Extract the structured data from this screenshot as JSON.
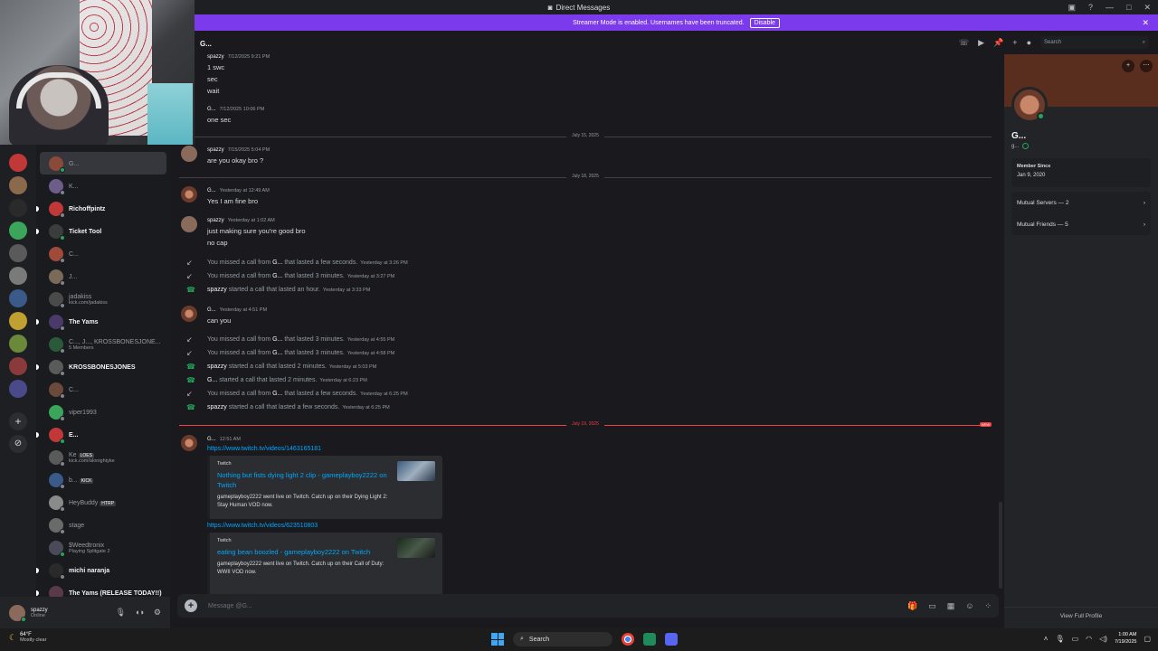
{
  "window": {
    "title": "Direct Messages"
  },
  "banner": {
    "text": "Streamer Mode is enabled. Usernames have been truncated.",
    "button": "Disable"
  },
  "header": {
    "name": "G...",
    "search_placeholder": "Search"
  },
  "sidebar": {
    "section_label": "Direct Messages",
    "items": [
      {
        "name": "G...",
        "sub": "",
        "bold": false,
        "selected": true,
        "color": "#8a4a3a",
        "online": true
      },
      {
        "name": "K...",
        "sub": "",
        "bold": false,
        "selected": false,
        "color": "#6d5d8a",
        "online": false
      },
      {
        "name": "Richoffpintz",
        "sub": "",
        "bold": true,
        "selected": false,
        "color": "#c03838",
        "online": false
      },
      {
        "name": "Ticket Tool",
        "sub": "",
        "bold": true,
        "selected": false,
        "color": "#3c3c3c",
        "online": true
      },
      {
        "name": "C...",
        "sub": "",
        "bold": false,
        "selected": false,
        "color": "#a04a3a",
        "online": false
      },
      {
        "name": "J...",
        "sub": "",
        "bold": false,
        "selected": false,
        "color": "#7a6a5a",
        "online": false
      },
      {
        "name": "jadakiss",
        "sub": "kick.com/jadakiss",
        "bold": false,
        "selected": false,
        "color": "#4a4a4a",
        "online": false
      },
      {
        "name": "The Yams",
        "sub": "",
        "bold": true,
        "selected": false,
        "color": "#4a3a6a",
        "online": false
      },
      {
        "name": "C..., J..., KROSSBONESJONE...",
        "sub": "5 Members",
        "bold": false,
        "selected": false,
        "color": "#2a5a3a",
        "online": false
      },
      {
        "name": "KROSSBONESJONES",
        "sub": "",
        "bold": true,
        "selected": false,
        "color": "#5a5a5a",
        "online": false
      },
      {
        "name": "C...",
        "sub": "",
        "bold": false,
        "selected": false,
        "color": "#6a4a3a",
        "online": false
      },
      {
        "name": "viper1993",
        "sub": "",
        "bold": false,
        "selected": false,
        "color": "#3ba55c",
        "online": false
      },
      {
        "name": "E...",
        "sub": "",
        "bold": true,
        "selected": false,
        "color": "#c03838",
        "online": true
      },
      {
        "name": "Ke",
        "tag": "LOES",
        "sub": "kick.com/alonightyke",
        "bold": false,
        "selected": false,
        "color": "#5a5a5a",
        "online": false
      },
      {
        "name": "b...",
        "tag": "KICK",
        "sub": "",
        "bold": false,
        "selected": false,
        "color": "#3a5a8a",
        "online": false
      },
      {
        "name": "HeyBuddy",
        "tag": "HTRP",
        "sub": "",
        "bold": false,
        "selected": false,
        "color": "#8a8a8a",
        "online": false
      },
      {
        "name": "stage",
        "sub": "",
        "bold": false,
        "selected": false,
        "color": "#6a6a6a",
        "online": false
      },
      {
        "name": "$Weedtronix",
        "sub": "Playing Splitgate 2",
        "bold": false,
        "selected": false,
        "color": "#4a4a5a",
        "online": true
      },
      {
        "name": "michi naranja",
        "sub": "",
        "bold": true,
        "selected": false,
        "color": "#2a2a2a",
        "online": false
      },
      {
        "name": "The Yams (RELEASE TODAY!!)",
        "sub": "",
        "bold": true,
        "selected": false,
        "color": "#5a3a4a",
        "online": false
      }
    ]
  },
  "user_panel": {
    "name": "spazzy",
    "status": "Online"
  },
  "messages": {
    "m1_author": "spazzy",
    "m1_time": "7/12/2025 9:21 PM",
    "m1_lines": [
      "1 swc",
      "sec",
      "wait"
    ],
    "m2_author": "G...",
    "m2_time": "7/12/2025 10:06 PM",
    "m2_line": "one sec",
    "div1": "July 15, 2025",
    "m3_author": "spazzy",
    "m3_time": "7/15/2025 5:04 PM",
    "m3_line": "are you okay bro ?",
    "div2": "July 18, 2025",
    "m4_author": "G...",
    "m4_time": "Yesterday at 12:49 AM",
    "m4_line": "Yes I am fine bro",
    "m5_author": "spazzy",
    "m5_time": "Yesterday at 1:02 AM",
    "m5_lines": [
      "just making sure you're good bro",
      "no cap"
    ],
    "calls1": [
      {
        "type": "miss",
        "pre": "You missed a call from ",
        "who": "G...",
        "post": " that lasted a few seconds.",
        "ts": "Yesterday at 3:26 PM"
      },
      {
        "type": "miss",
        "pre": "You missed a call from ",
        "who": "G...",
        "post": " that lasted 3 minutes.",
        "ts": "Yesterday at 3:27 PM"
      },
      {
        "type": "ok",
        "pre": "",
        "who": "spazzy",
        "post": " started a call that lasted an hour.",
        "ts": "Yesterday at 3:33 PM"
      }
    ],
    "m6_author": "G...",
    "m6_time": "Yesterday at 4:51 PM",
    "m6_line": "can you",
    "calls2": [
      {
        "type": "miss",
        "pre": "You missed a call from ",
        "who": "G...",
        "post": " that lasted 3 minutes.",
        "ts": "Yesterday at 4:55 PM"
      },
      {
        "type": "miss",
        "pre": "You missed a call from ",
        "who": "G...",
        "post": " that lasted 3 minutes.",
        "ts": "Yesterday at 4:58 PM"
      },
      {
        "type": "ok",
        "pre": "",
        "who": "spazzy",
        "post": " started a call that lasted 2 minutes.",
        "ts": "Yesterday at 5:03 PM"
      },
      {
        "type": "ok",
        "pre": "",
        "who": "G...",
        "post": " started a call that lasted 2 minutes.",
        "ts": "Yesterday at 6:23 PM"
      },
      {
        "type": "miss",
        "pre": "You missed a call from ",
        "who": "G...",
        "post": " that lasted a few seconds.",
        "ts": "Yesterday at 6:25 PM"
      },
      {
        "type": "ok",
        "pre": "",
        "who": "spazzy",
        "post": " started a call that lasted a few seconds.",
        "ts": "Yesterday at 6:25 PM"
      }
    ],
    "div3": "July 19, 2025",
    "new_label": "NEW",
    "m7_author": "G...",
    "m7_time": "12:51 AM",
    "link1": "https://www.twitch.tv/videos/1463165181",
    "embed1": {
      "provider": "Twitch",
      "title": "Nothing but fists dying light 2 clip - gameplayboy2222 on Twitch",
      "desc": "gameplayboy2222 went live on Twitch. Catch up on their Dying Light 2: Stay Human VOD now."
    },
    "link2": "https://www.twitch.tv/videos/623510803",
    "embed2": {
      "provider": "Twitch",
      "title": "eating bean boozled  - gameplayboy2222 on Twitch",
      "desc": "gameplayboy2222 went live on Twitch. Catch up on their Call of Duty: WWII VOD now."
    }
  },
  "composer": {
    "placeholder": "Message @G..."
  },
  "profile": {
    "name": "G...",
    "username": "g...",
    "member_since_label": "Member Since",
    "member_since": "Jan 9, 2020",
    "mutual_servers": "Mutual Servers — 2",
    "mutual_friends": "Mutual Friends — 5",
    "view_full": "View Full Profile"
  },
  "taskbar": {
    "temp": "64°F",
    "weather": "Mostly clear",
    "search": "Search",
    "time": "1:00 AM",
    "date": "7/19/2025"
  },
  "colors": {
    "accent": "#7c3aed",
    "online": "#23a55a",
    "link": "#00a8fc",
    "new": "#f23f43"
  }
}
